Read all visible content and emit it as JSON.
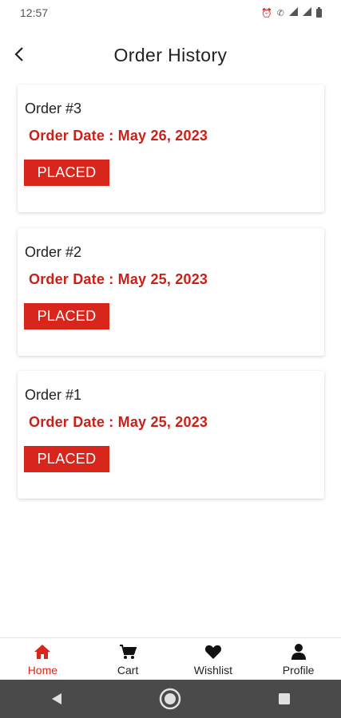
{
  "status_bar": {
    "time": "12:57",
    "icons": [
      "alarm-icon",
      "wifi-call-icon",
      "signal-icon",
      "lte-signal-icon",
      "battery-icon"
    ]
  },
  "header": {
    "back_icon": "chevron-left-icon",
    "title": "Order History"
  },
  "orders": [
    {
      "title": "Order #3",
      "date": "Order Date : May 26, 2023",
      "status": "PLACED"
    },
    {
      "title": "Order #2",
      "date": "Order Date : May 25, 2023",
      "status": "PLACED"
    },
    {
      "title": "Order #1",
      "date": "Order Date : May 25, 2023",
      "status": "PLACED"
    }
  ],
  "bottom_nav": {
    "items": [
      {
        "label": "Home",
        "icon": "home-icon",
        "active": true
      },
      {
        "label": "Cart",
        "icon": "cart-icon",
        "active": false
      },
      {
        "label": "Wishlist",
        "icon": "heart-icon",
        "active": false
      },
      {
        "label": "Profile",
        "icon": "user-icon",
        "active": false
      }
    ]
  },
  "system_nav": {
    "icons": [
      "back-triangle-icon",
      "home-circle-icon",
      "recents-square-icon"
    ]
  },
  "colors": {
    "accent": "#d8261c",
    "date_text": "#c92119",
    "system_nav_bg": "#4a4a4a"
  }
}
